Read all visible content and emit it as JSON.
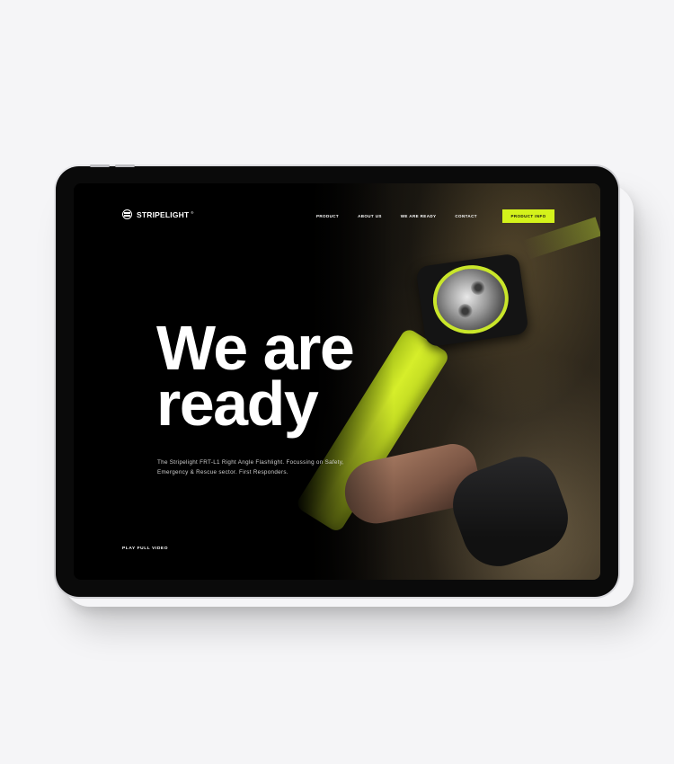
{
  "brand": {
    "name": "STRIPELIGHT",
    "registered_mark": "®"
  },
  "nav": {
    "links": [
      "PRODUCT",
      "ABOUT US",
      "WE ARE READY",
      "CONTACT"
    ],
    "cta_label": "PRODUCT INFO"
  },
  "hero": {
    "headline_line1": "We are",
    "headline_line2": "ready",
    "description": "The Stripelight FRT-L1 Right Angle Flashlight. Focussing on Safety, Emergency & Rescue sector. First Responders.",
    "video_link": "PLAY FULL VIDEO"
  },
  "colors": {
    "accent": "#d4f21b",
    "background": "#000000",
    "page_background": "#f5f5f7"
  }
}
